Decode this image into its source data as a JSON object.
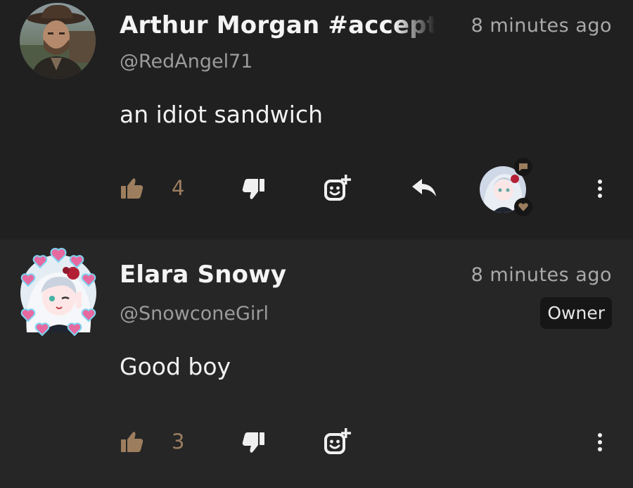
{
  "comments": [
    {
      "author": "Arthur Morgan #accepta",
      "handle": "@RedAngel71",
      "time": "8 minutes ago",
      "text": "an idiot sandwich",
      "likes": "4"
    },
    {
      "author": "Elara Snowy",
      "handle": "@SnowconeGirl",
      "time": "8 minutes ago",
      "badge": "Owner",
      "text": "Good boy",
      "likes": "3"
    }
  ],
  "colors": {
    "background": "#202021",
    "highlight_background": "#262627",
    "accent_brown": "#9c7e5e",
    "icon_white": "#f0f0f0",
    "muted_text": "#9b9b9b"
  }
}
